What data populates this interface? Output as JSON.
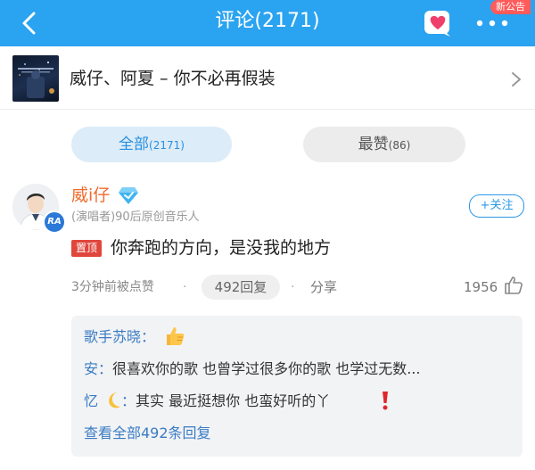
{
  "header": {
    "title": "评论(2171)",
    "notice_badge": "新公告",
    "icons": [
      "back-icon",
      "heart-icon",
      "more-icon"
    ],
    "bg_color": "#2aa3f0"
  },
  "song": {
    "title": "威仔、阿夏 – 你不必再假装"
  },
  "tabs": [
    {
      "label": "全部",
      "count": "(2171)",
      "active": true
    },
    {
      "label": "最赞",
      "count": "(86)",
      "active": false
    }
  ],
  "comment": {
    "username": "威i仔",
    "subtitle": "(演唱者)90后原创音乐人",
    "follow_label": "+关注",
    "pin_label": "置顶",
    "text": "你奔跑的方向，是没我的地方",
    "time": "3分钟前被点赞",
    "reply_count": "492回复",
    "share_label": "分享",
    "like_count": "1956",
    "verify_badge": "RA",
    "username_color": "#ef6b2e"
  },
  "replies": {
    "items": [
      {
        "name": "歌手苏晓：",
        "text": ""
      },
      {
        "name": "安：",
        "text": "很喜欢你的歌  也曾学过很多你的歌   也学过无数..."
      },
      {
        "name": "忆",
        "suffix": "：",
        "text": "其实 最近挺想你 也蛮好听的丫"
      }
    ],
    "view_all": "查看全部492条回复"
  }
}
